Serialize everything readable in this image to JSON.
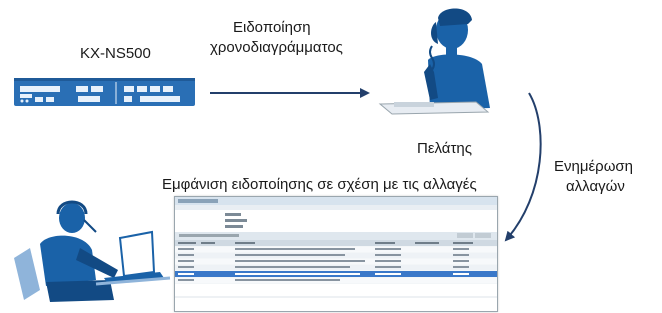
{
  "device": {
    "label": "KX-NS500"
  },
  "arrow_notification": {
    "label_line1": "Ειδοποίηση",
    "label_line2": "χρονοδιαγράμματος"
  },
  "customer": {
    "label": "Πελάτης"
  },
  "arrow_update": {
    "label_line1": "Ενημέρωση",
    "label_line2": "αλλαγών"
  },
  "screen": {
    "label": "Εμφάνιση ειδοποίησης σε σχέση με τις αλλαγές"
  },
  "colors": {
    "figure_blue": "#1a62a8",
    "device_blue": "#2a6fb5",
    "arrow": "#233f6b",
    "highlight_row": "#3a78c9"
  }
}
